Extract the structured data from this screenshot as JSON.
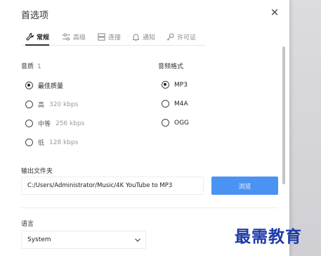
{
  "dialog": {
    "title": "首选项",
    "close_glyph": "×"
  },
  "tabs": [
    {
      "label": "常规",
      "icon": "wrench-icon",
      "active": true
    },
    {
      "label": "高级",
      "icon": "sliders-icon",
      "active": false
    },
    {
      "label": "连接",
      "icon": "server-icon",
      "active": false
    },
    {
      "label": "通知",
      "icon": "bell-icon",
      "active": false
    },
    {
      "label": "许可证",
      "icon": "key-icon",
      "active": false
    }
  ],
  "quality": {
    "label": "音质",
    "number": "1",
    "options": [
      {
        "label": "最佳质量",
        "extra": "",
        "checked": true
      },
      {
        "label": "高",
        "extra": "320 kbps",
        "checked": false
      },
      {
        "label": "中等",
        "extra": "256 kbps",
        "checked": false
      },
      {
        "label": "低",
        "extra": "128 kbps",
        "checked": false
      }
    ]
  },
  "format": {
    "label": "音频格式",
    "options": [
      {
        "label": "MP3",
        "checked": true
      },
      {
        "label": "M4A",
        "checked": false
      },
      {
        "label": "OGG",
        "checked": false
      }
    ]
  },
  "output": {
    "label": "输出文件夹",
    "path": "C:/Users/Administrator/Music/4K YouTube to MP3",
    "browse_label": "浏览"
  },
  "language": {
    "label": "语言",
    "value": "System"
  },
  "watermark": {
    "text": "最需教育"
  },
  "colors": {
    "accent": "#4a93f2",
    "watermark": "#1d3aa8"
  }
}
